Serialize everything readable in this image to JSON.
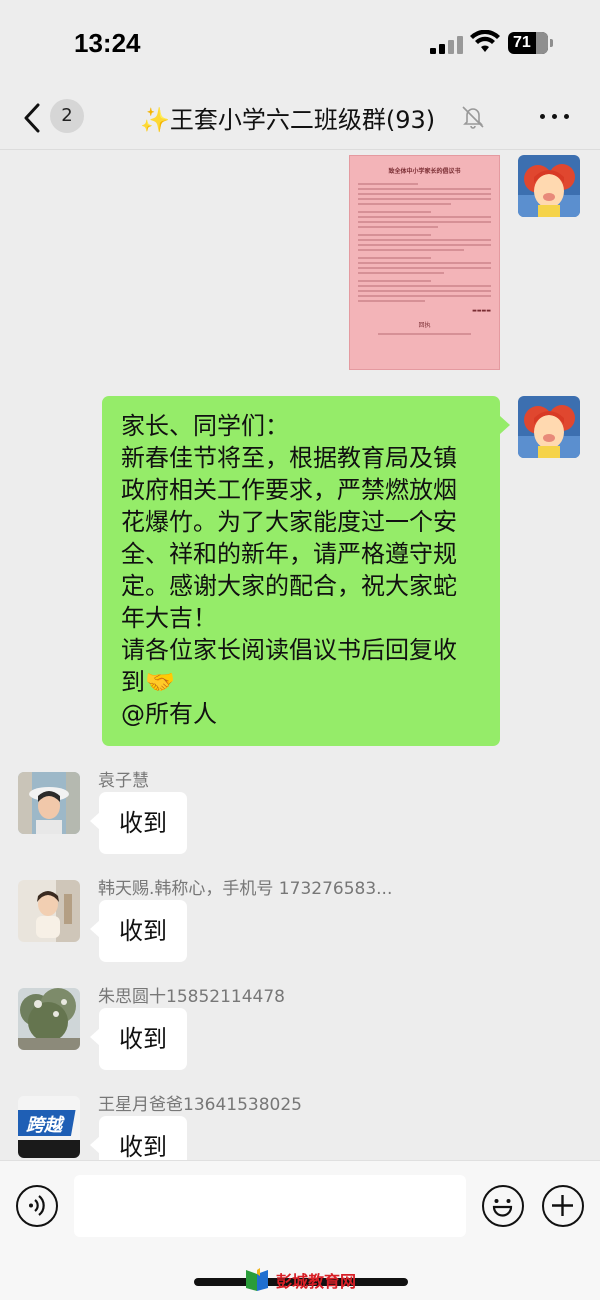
{
  "status_bar": {
    "time": "13:24",
    "battery": "71"
  },
  "nav": {
    "unread_count": "2",
    "title": "✨王套小学六二班级群(93)",
    "icons": [
      "back-arrow-icon",
      "mute-bell-icon",
      "more-icon"
    ]
  },
  "messages": [
    {
      "side": "sent",
      "type": "image",
      "image": {
        "title": "致全体中小学家长的倡议书",
        "footer": "回执"
      }
    },
    {
      "side": "sent",
      "type": "text",
      "lines": [
        "家长、同学们：",
        "新春佳节将至，根据教育局及镇",
        "政府相关工作要求，严禁燃放烟",
        "花爆竹。为了大家能度过一个安",
        "全、祥和的新年，请严格遵守规",
        "定。感谢大家的配合，祝大家蛇",
        "年大吉！",
        "请各位家长阅读倡议书后回复收",
        "到🤝",
        "@所有人"
      ]
    },
    {
      "side": "received",
      "sender": "袁子慧",
      "text": "收到"
    },
    {
      "side": "received",
      "sender": "韩天赐.韩称心，手机号 173276583...",
      "text": "收到"
    },
    {
      "side": "received",
      "sender": "朱思圆十15852114478",
      "text": "收到"
    },
    {
      "side": "received",
      "sender": "王星月爸爸13641538025",
      "text": "收到",
      "avatar_text": "跨越"
    }
  ],
  "input_bar": {
    "placeholder": "",
    "icons": [
      "voice-icon",
      "emoji-icon",
      "plus-icon"
    ]
  },
  "watermark": "彭城教育网",
  "colors": {
    "background": "#ededed",
    "sent_bubble": "#95ec69",
    "received_bubble": "#ffffff",
    "watermark": "#d81f26"
  }
}
